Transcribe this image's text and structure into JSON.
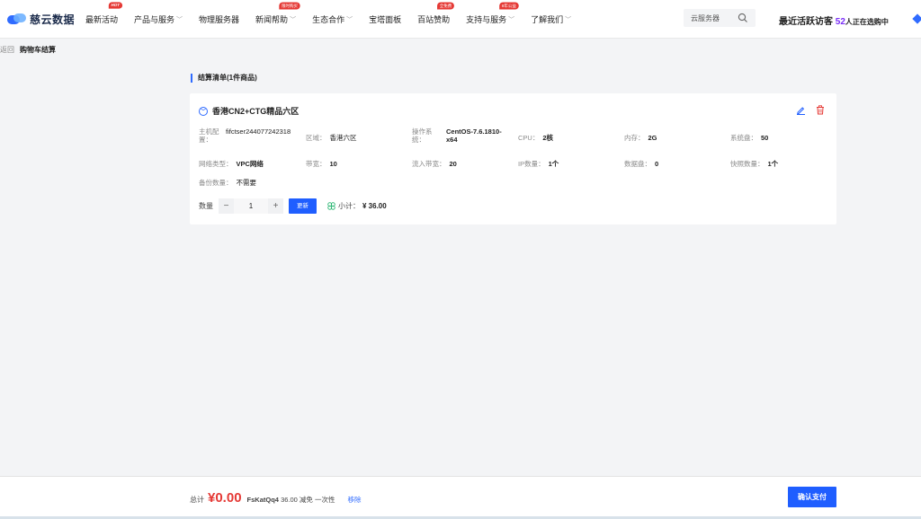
{
  "header": {
    "logo_text": "慈云数据",
    "nav": [
      {
        "label": "最新活动",
        "badge": "HOT",
        "chevron": false
      },
      {
        "label": "产品与服务",
        "badge": "",
        "chevron": true
      },
      {
        "label": "物理服务器",
        "badge": "",
        "chevron": false
      },
      {
        "label": "新闻帮助",
        "badge": "限时购买",
        "chevron": true
      },
      {
        "label": "生态合作",
        "badge": "",
        "chevron": true
      },
      {
        "label": "宝塔面板",
        "badge": "",
        "chevron": false
      },
      {
        "label": "百站赞助",
        "badge": "全免费",
        "chevron": false
      },
      {
        "label": "支持与服务",
        "badge": "8年公益",
        "chevron": true
      },
      {
        "label": "了解我们",
        "badge": "",
        "chevron": true
      }
    ],
    "search_placeholder": "云服务器",
    "visitors_prefix": "最近活跃访客",
    "visitors_count": "52",
    "visitors_suffix": "人正在选购中"
  },
  "breadcrumb": {
    "back": "返回",
    "current": "购物车结算"
  },
  "section_title": "结算清单(1件商品)",
  "item": {
    "title": "香港CN2+CTG精品六区",
    "specs_row1": [
      {
        "k": "主机配置：",
        "v": "fifctser244077242318"
      },
      {
        "k": "区域：",
        "v": "香港六区"
      },
      {
        "k": "操作系统：",
        "v": "CentOS-7.6.1810-x64"
      },
      {
        "k": "CPU：",
        "v": "2核"
      },
      {
        "k": "内存：",
        "v": "2G"
      },
      {
        "k": "系统盘：",
        "v": "50"
      }
    ],
    "specs_row2": [
      {
        "k": "网络类型：",
        "v": "VPC网络"
      },
      {
        "k": "带宽：",
        "v": "10"
      },
      {
        "k": "流入带宽：",
        "v": "20"
      },
      {
        "k": "IP数量：",
        "v": "1个"
      },
      {
        "k": "数据盘：",
        "v": "0"
      },
      {
        "k": "快照数量：",
        "v": "1个"
      }
    ],
    "specs_row3": [
      {
        "k": "备份数量：",
        "v": "不需要"
      }
    ],
    "qty_label": "数量",
    "qty_value": "1",
    "minus": "−",
    "plus": "+",
    "update_label": "更新",
    "subtotal_label": "小计：",
    "subtotal_value": "¥ 36.00"
  },
  "footer": {
    "total_label": "总计",
    "total_value": "¥0.00",
    "coupon_code": "FsKatQq4",
    "coupon_text": "36.00 减免 一次性",
    "remove_label": "移除",
    "confirm_label": "确认支付"
  },
  "colors": {
    "accent": "#1f5eff",
    "price": "#e53935",
    "visitor_count": "#7b2ff7"
  }
}
